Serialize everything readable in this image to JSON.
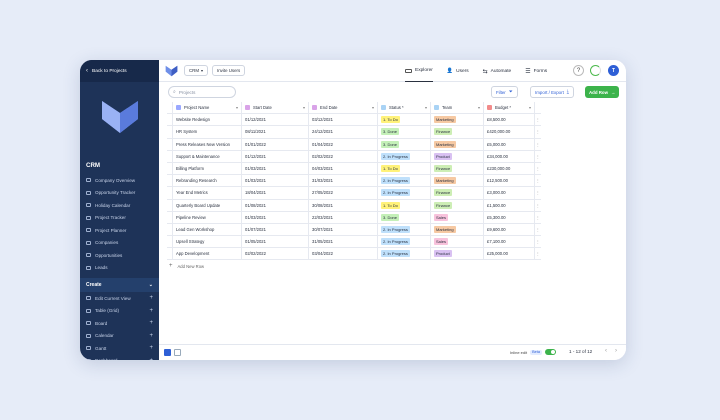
{
  "sidebar": {
    "back_label": "Back to Projects",
    "app_title": "CRM",
    "nav_items": [
      {
        "label": "Company Overview"
      },
      {
        "label": "Opportunity Tracker"
      },
      {
        "label": "Holiday Calendar"
      },
      {
        "label": "Project Tracker"
      },
      {
        "label": "Project Planner"
      },
      {
        "label": "Companies"
      },
      {
        "label": "Opportunities"
      },
      {
        "label": "Leads"
      }
    ],
    "create_label": "Create",
    "create_items": [
      {
        "label": "Edit Current View"
      },
      {
        "label": "Table (Grid)"
      },
      {
        "label": "Board"
      },
      {
        "label": "Calendar"
      },
      {
        "label": "Gantt"
      },
      {
        "label": "Dashboard"
      }
    ]
  },
  "topbar": {
    "crm_select": "CRM",
    "invite_label": "Invite Users",
    "tabs": [
      {
        "label": "Explorer"
      },
      {
        "label": "Users"
      },
      {
        "label": "Automate"
      },
      {
        "label": "Forms"
      }
    ],
    "help_label": "?",
    "avatar_initial": "T"
  },
  "toolbar": {
    "search_placeholder": "Projects",
    "filter_label": "Filter",
    "import_label": "Import / Export",
    "add_row_label": "Add Row"
  },
  "table": {
    "columns": [
      {
        "label": "Project Name",
        "icon_color": "#9aa8ff"
      },
      {
        "label": "Start Date",
        "icon_color": "#d9a3e8"
      },
      {
        "label": "End Date",
        "icon_color": "#d9a3e8"
      },
      {
        "label": "Status *",
        "icon_color": "#a9d3f5"
      },
      {
        "label": "Team",
        "icon_color": "#a9d3f5"
      },
      {
        "label": "Budget *",
        "icon_color": "#f28b8b"
      }
    ],
    "rows": [
      {
        "name": "Website Redesign",
        "start": "01/12/2021",
        "end": "03/12/2021",
        "status": "1. To Do",
        "team": "Marketing",
        "budget": "£8,500.00"
      },
      {
        "name": "HR System",
        "start": "08/11/2021",
        "end": "24/12/2021",
        "status": "3. Done",
        "team": "Finance",
        "budget": "£420,000.00"
      },
      {
        "name": "Press Releases New Version",
        "start": "01/01/2022",
        "end": "01/04/2022",
        "status": "3. Done",
        "team": "Marketing",
        "budget": "£5,000.00"
      },
      {
        "name": "Support & Maintenance",
        "start": "01/12/2021",
        "end": "02/02/2022",
        "status": "2. In Progress",
        "team": "Product",
        "budget": "£34,000.00"
      },
      {
        "name": "Billing Platform",
        "start": "01/03/2021",
        "end": "04/03/2021",
        "status": "1. To Do",
        "team": "Finance",
        "budget": "£230,000.00"
      },
      {
        "name": "Rebranding Research",
        "start": "01/03/2021",
        "end": "31/03/2021",
        "status": "2. In Progress",
        "team": "Marketing",
        "budget": "£12,500.00"
      },
      {
        "name": "Year End Metrics",
        "start": "18/04/2021",
        "end": "27/05/2022",
        "status": "2. In Progress",
        "team": "Finance",
        "budget": "£3,000.00"
      },
      {
        "name": "Quarterly Board Update",
        "start": "01/08/2021",
        "end": "30/08/2021",
        "status": "1. To Do",
        "team": "Finance",
        "budget": "£1,500.00"
      },
      {
        "name": "Pipeline Review",
        "start": "01/03/2021",
        "end": "22/03/2021",
        "status": "3. Done",
        "team": "Sales",
        "budget": "£5,300.00"
      },
      {
        "name": "Lead Gen Workshop",
        "start": "01/07/2021",
        "end": "30/07/2021",
        "status": "2. In Progress",
        "team": "Marketing",
        "budget": "£9,600.00"
      },
      {
        "name": "Upsell Strategy",
        "start": "01/05/2021",
        "end": "31/05/2021",
        "status": "2. In Progress",
        "team": "Sales",
        "budget": "£7,100.00"
      },
      {
        "name": "App Development",
        "start": "02/02/2022",
        "end": "03/04/2022",
        "status": "2. In Progress",
        "team": "Product",
        "budget": "£25,000.00"
      }
    ],
    "add_new_row_label": "Add New Row"
  },
  "colors": {
    "status": {
      "1. To Do": "#fff27a",
      "3. Done": "#c4f0b8",
      "2. In Progress": "#bfe0fb"
    },
    "team": {
      "Marketing": "#f6c9a3",
      "Finance": "#cdeeb5",
      "Product": "#d9c1f2",
      "Sales": "#f8c2dc"
    }
  },
  "footer": {
    "inline_edit_label": "Inline edit",
    "beta_label": "Beta",
    "pager_label": "1 - 12 of 12"
  }
}
